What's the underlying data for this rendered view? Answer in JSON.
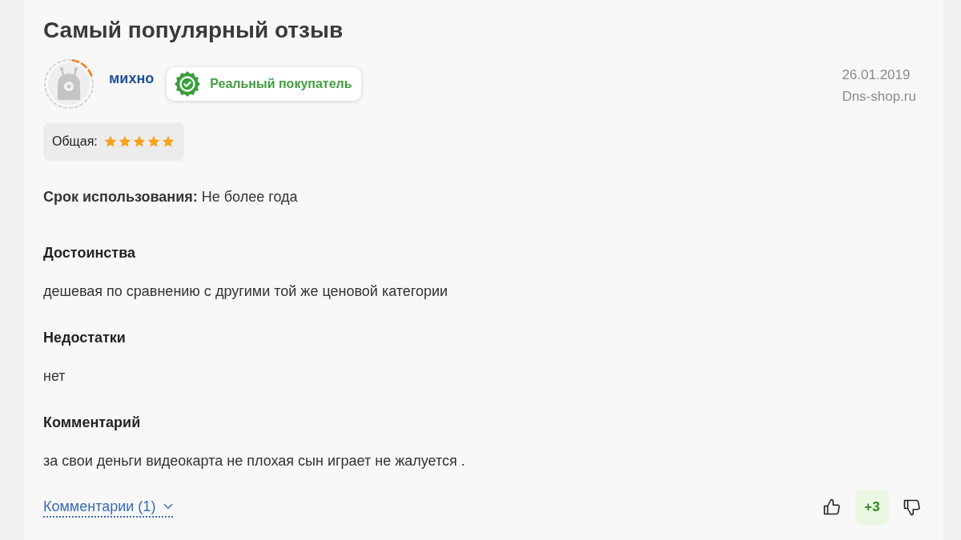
{
  "title": "Самый популярный отзыв",
  "author": {
    "name": "михно",
    "badge": "Реальный покупатель"
  },
  "meta": {
    "date": "26.01.2019",
    "source": "Dns-shop.ru"
  },
  "rating": {
    "label": "Общая:",
    "stars": 5
  },
  "usage": "**Срок использования:** Не более года",
  "sections": [
    {
      "heading": "Достоинства",
      "text": "дешевая по сравнению с другими той же ценовой категории"
    },
    {
      "heading": "Недостатки",
      "text": "нет"
    },
    {
      "heading": "Комментарий",
      "text": "за свои деньги видеокарта не плохая сын играет не жалуется ."
    }
  ],
  "comments_link": {
    "label": "Комментарии (1)",
    "expanded": false
  },
  "votes": {
    "score": "+3"
  }
}
